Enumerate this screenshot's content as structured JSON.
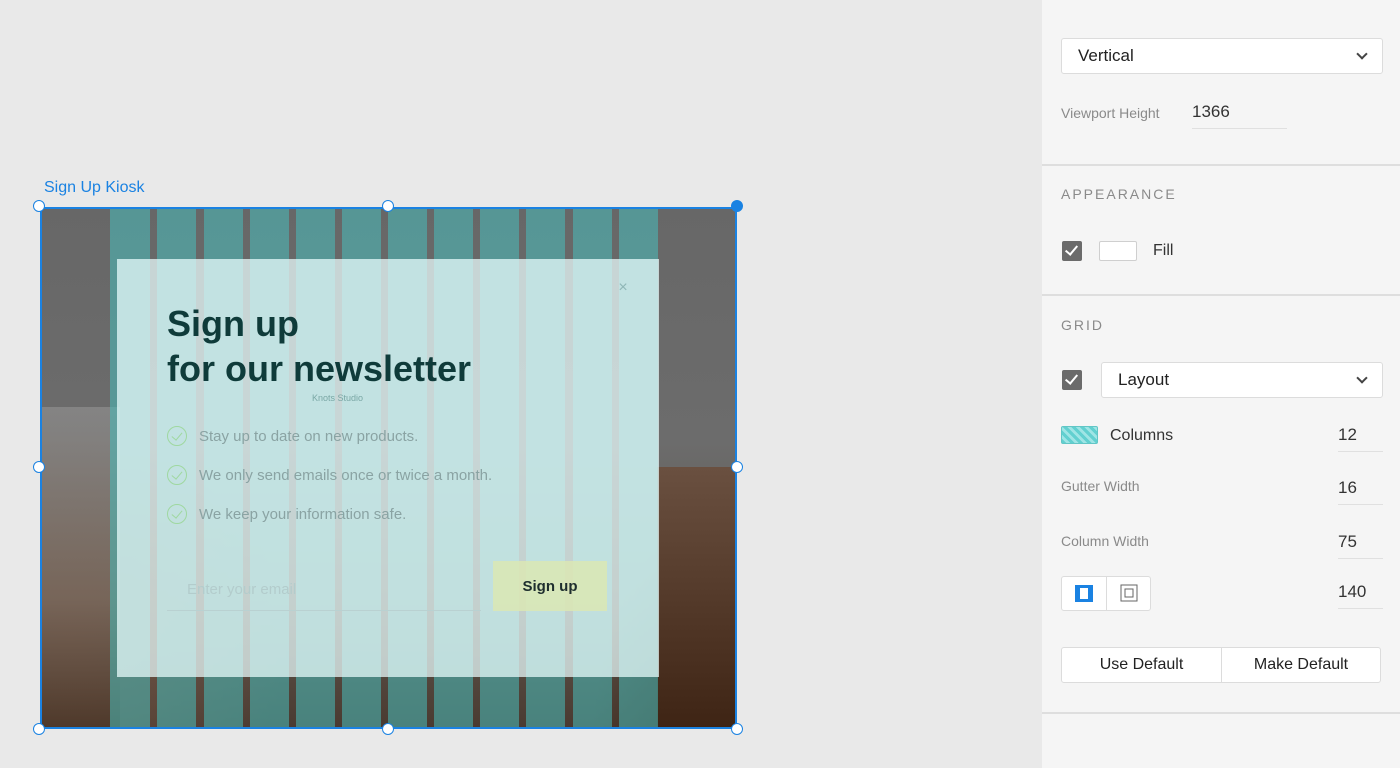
{
  "artboard": {
    "title": "Sign Up Kiosk",
    "modal": {
      "title_line1": "Sign up",
      "title_line2": "for our newsletter",
      "brand": "Knots Studio",
      "close_glyph": "×",
      "features": [
        "Stay up to date on new products.",
        "We only send emails once or twice a month.",
        "We keep your information safe."
      ],
      "email_placeholder": "Enter your email",
      "signup_label": "Sign up"
    }
  },
  "panel": {
    "scroll_mode": "Vertical",
    "viewport_height_label": "Viewport Height",
    "viewport_height_value": "1366",
    "appearance_title": "APPEARANCE",
    "fill_label": "Fill",
    "fill_checked": true,
    "fill_color": "#ffffff",
    "grid_title": "GRID",
    "grid_checked": true,
    "grid_type": "Layout",
    "columns_label": "Columns",
    "columns_value": "12",
    "gutter_label": "Gutter Width",
    "gutter_value": "16",
    "column_width_label": "Column Width",
    "column_width_value": "75",
    "margin_value": "140",
    "use_default_label": "Use Default",
    "make_default_label": "Make Default"
  },
  "colors": {
    "selection": "#1a82e2",
    "grid_column": "#48bebc",
    "title_text": "#0f3b3a"
  }
}
